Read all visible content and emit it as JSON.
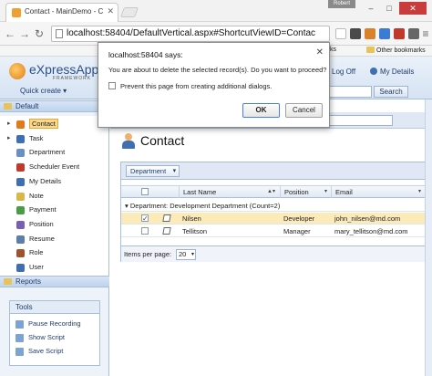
{
  "browser": {
    "tab_title": "Contact - MainDemo - C",
    "user_label": "Robert",
    "url": "localhost:58404/DefaultVertical.aspx#ShortcutViewID=Contac",
    "bookmarks_partial": "ks",
    "other_bookmarks": "Other bookmarks"
  },
  "dialog": {
    "title": "localhost:58404 says:",
    "message": "You are about to delete the selected record(s). Do you want to proceed?",
    "checkbox_label": "Prevent this page from creating additional dialogs.",
    "ok_label": "OK",
    "cancel_label": "Cancel"
  },
  "app": {
    "logo_text": "eXpressApp",
    "logo_sub": "FRAMEWORK",
    "quick_create": "Quick create ▾",
    "log_off": "Log Off",
    "my_details": "My Details",
    "search_label": "Search"
  },
  "sidebar": {
    "default_header": "Default",
    "items": [
      {
        "label": "Contact",
        "expandable": true,
        "selected": true
      },
      {
        "label": "Task",
        "expandable": true,
        "selected": false
      },
      {
        "label": "Department",
        "expandable": false,
        "selected": false
      },
      {
        "label": "Scheduler Event",
        "expandable": false,
        "selected": false
      },
      {
        "label": "My Details",
        "expandable": false,
        "selected": false
      },
      {
        "label": "Note",
        "expandable": false,
        "selected": false
      },
      {
        "label": "Payment",
        "expandable": false,
        "selected": false
      },
      {
        "label": "Position",
        "expandable": false,
        "selected": false
      },
      {
        "label": "Resume",
        "expandable": false,
        "selected": false
      },
      {
        "label": "Role",
        "expandable": false,
        "selected": false
      },
      {
        "label": "User",
        "expandable": false,
        "selected": false
      }
    ],
    "reports_header": "Reports",
    "tools": {
      "title": "Tools",
      "items": [
        "Pause Recording",
        "Show Script",
        "Save Script"
      ]
    }
  },
  "main": {
    "page_title": "Contact",
    "group_chip": "Department",
    "columns": [
      "Last Name",
      "Position",
      "Email"
    ],
    "group_row": "Department: Development Department (Count=2)",
    "rows": [
      {
        "last_name": "Nilsen",
        "position": "Developer",
        "email": "john_nilsen@md.com",
        "checked": true
      },
      {
        "last_name": "Tellitson",
        "position": "Manager",
        "email": "mary_tellitson@md.com",
        "checked": false
      }
    ],
    "pager_label": "Items per page:",
    "pager_value": "20"
  }
}
